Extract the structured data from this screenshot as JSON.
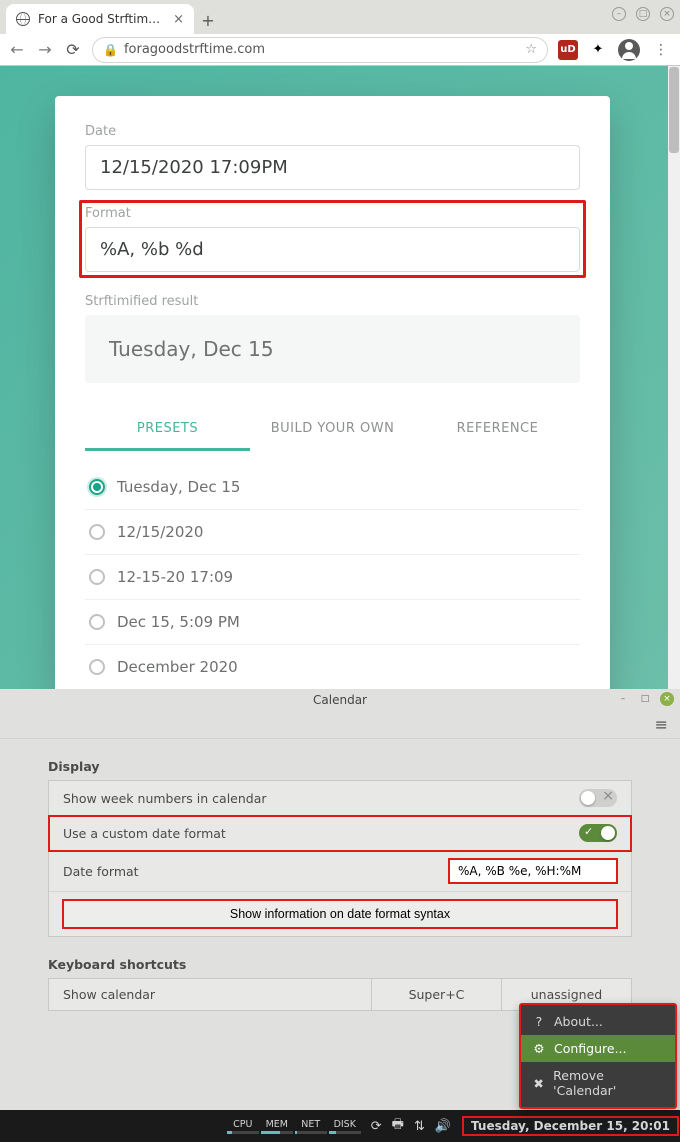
{
  "browser": {
    "tab_title": "For a Good Strftime | Easy Sk",
    "url": "foragoodstrftime.com",
    "shield_label": "uD"
  },
  "strftime": {
    "date_label": "Date",
    "date_value": "12/15/2020 17:09PM",
    "format_label": "Format",
    "format_value": "%A, %b %d",
    "result_label": "Strftimified result",
    "result_value": "Tuesday, Dec 15",
    "tabs": {
      "presets": "PRESETS",
      "build": "BUILD YOUR OWN",
      "reference": "REFERENCE"
    },
    "presets": [
      "Tuesday, Dec 15",
      "12/15/2020",
      "12-15-20 17:09",
      "Dec 15, 5:09 PM",
      "December 2020"
    ]
  },
  "cal": {
    "title": "Calendar",
    "display_heading": "Display",
    "show_week": "Show week numbers in calendar",
    "custom_fmt": "Use a custom date format",
    "date_format_lbl": "Date format",
    "date_format_val": "%A, %B %e, %H:%M",
    "show_info_btn": "Show information on date format syntax",
    "kb_heading": "Keyboard shortcuts",
    "show_calendar": "Show calendar",
    "shortcut1": "Super+C",
    "shortcut2": "unassigned"
  },
  "ctx": {
    "about": "About...",
    "configure": "Configure...",
    "remove": "Remove 'Calendar'"
  },
  "taskbar": {
    "meters": [
      "CPU",
      "MEM",
      "NET",
      "DISK"
    ],
    "meter_fill": [
      "15%",
      "60%",
      "8%",
      "22%"
    ],
    "clock": "Tuesday, December 15, 20:01"
  }
}
